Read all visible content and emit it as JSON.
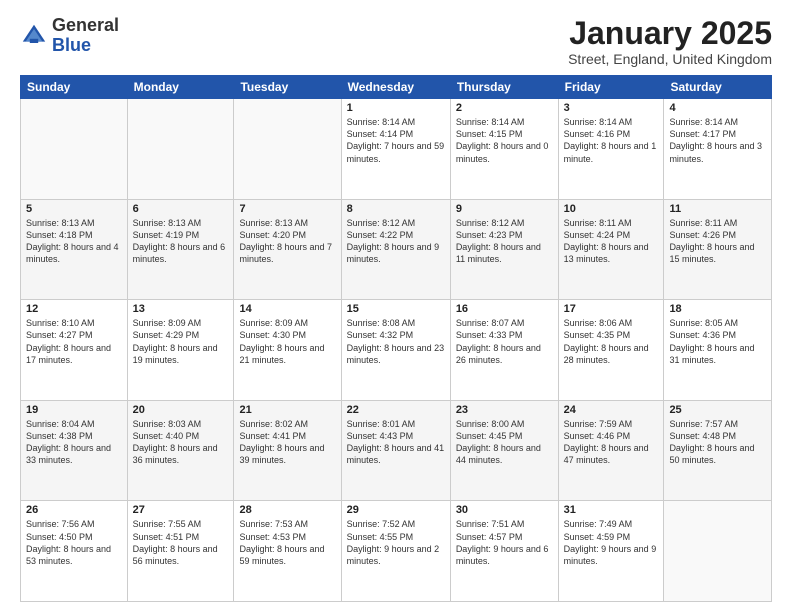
{
  "header": {
    "logo_general": "General",
    "logo_blue": "Blue",
    "title": "January 2025",
    "subtitle": "Street, England, United Kingdom"
  },
  "days_of_week": [
    "Sunday",
    "Monday",
    "Tuesday",
    "Wednesday",
    "Thursday",
    "Friday",
    "Saturday"
  ],
  "weeks": [
    [
      {
        "day": "",
        "sunrise": "",
        "sunset": "",
        "daylight": ""
      },
      {
        "day": "",
        "sunrise": "",
        "sunset": "",
        "daylight": ""
      },
      {
        "day": "",
        "sunrise": "",
        "sunset": "",
        "daylight": ""
      },
      {
        "day": "1",
        "sunrise": "Sunrise: 8:14 AM",
        "sunset": "Sunset: 4:14 PM",
        "daylight": "Daylight: 7 hours and 59 minutes."
      },
      {
        "day": "2",
        "sunrise": "Sunrise: 8:14 AM",
        "sunset": "Sunset: 4:15 PM",
        "daylight": "Daylight: 8 hours and 0 minutes."
      },
      {
        "day": "3",
        "sunrise": "Sunrise: 8:14 AM",
        "sunset": "Sunset: 4:16 PM",
        "daylight": "Daylight: 8 hours and 1 minute."
      },
      {
        "day": "4",
        "sunrise": "Sunrise: 8:14 AM",
        "sunset": "Sunset: 4:17 PM",
        "daylight": "Daylight: 8 hours and 3 minutes."
      }
    ],
    [
      {
        "day": "5",
        "sunrise": "Sunrise: 8:13 AM",
        "sunset": "Sunset: 4:18 PM",
        "daylight": "Daylight: 8 hours and 4 minutes."
      },
      {
        "day": "6",
        "sunrise": "Sunrise: 8:13 AM",
        "sunset": "Sunset: 4:19 PM",
        "daylight": "Daylight: 8 hours and 6 minutes."
      },
      {
        "day": "7",
        "sunrise": "Sunrise: 8:13 AM",
        "sunset": "Sunset: 4:20 PM",
        "daylight": "Daylight: 8 hours and 7 minutes."
      },
      {
        "day": "8",
        "sunrise": "Sunrise: 8:12 AM",
        "sunset": "Sunset: 4:22 PM",
        "daylight": "Daylight: 8 hours and 9 minutes."
      },
      {
        "day": "9",
        "sunrise": "Sunrise: 8:12 AM",
        "sunset": "Sunset: 4:23 PM",
        "daylight": "Daylight: 8 hours and 11 minutes."
      },
      {
        "day": "10",
        "sunrise": "Sunrise: 8:11 AM",
        "sunset": "Sunset: 4:24 PM",
        "daylight": "Daylight: 8 hours and 13 minutes."
      },
      {
        "day": "11",
        "sunrise": "Sunrise: 8:11 AM",
        "sunset": "Sunset: 4:26 PM",
        "daylight": "Daylight: 8 hours and 15 minutes."
      }
    ],
    [
      {
        "day": "12",
        "sunrise": "Sunrise: 8:10 AM",
        "sunset": "Sunset: 4:27 PM",
        "daylight": "Daylight: 8 hours and 17 minutes."
      },
      {
        "day": "13",
        "sunrise": "Sunrise: 8:09 AM",
        "sunset": "Sunset: 4:29 PM",
        "daylight": "Daylight: 8 hours and 19 minutes."
      },
      {
        "day": "14",
        "sunrise": "Sunrise: 8:09 AM",
        "sunset": "Sunset: 4:30 PM",
        "daylight": "Daylight: 8 hours and 21 minutes."
      },
      {
        "day": "15",
        "sunrise": "Sunrise: 8:08 AM",
        "sunset": "Sunset: 4:32 PM",
        "daylight": "Daylight: 8 hours and 23 minutes."
      },
      {
        "day": "16",
        "sunrise": "Sunrise: 8:07 AM",
        "sunset": "Sunset: 4:33 PM",
        "daylight": "Daylight: 8 hours and 26 minutes."
      },
      {
        "day": "17",
        "sunrise": "Sunrise: 8:06 AM",
        "sunset": "Sunset: 4:35 PM",
        "daylight": "Daylight: 8 hours and 28 minutes."
      },
      {
        "day": "18",
        "sunrise": "Sunrise: 8:05 AM",
        "sunset": "Sunset: 4:36 PM",
        "daylight": "Daylight: 8 hours and 31 minutes."
      }
    ],
    [
      {
        "day": "19",
        "sunrise": "Sunrise: 8:04 AM",
        "sunset": "Sunset: 4:38 PM",
        "daylight": "Daylight: 8 hours and 33 minutes."
      },
      {
        "day": "20",
        "sunrise": "Sunrise: 8:03 AM",
        "sunset": "Sunset: 4:40 PM",
        "daylight": "Daylight: 8 hours and 36 minutes."
      },
      {
        "day": "21",
        "sunrise": "Sunrise: 8:02 AM",
        "sunset": "Sunset: 4:41 PM",
        "daylight": "Daylight: 8 hours and 39 minutes."
      },
      {
        "day": "22",
        "sunrise": "Sunrise: 8:01 AM",
        "sunset": "Sunset: 4:43 PM",
        "daylight": "Daylight: 8 hours and 41 minutes."
      },
      {
        "day": "23",
        "sunrise": "Sunrise: 8:00 AM",
        "sunset": "Sunset: 4:45 PM",
        "daylight": "Daylight: 8 hours and 44 minutes."
      },
      {
        "day": "24",
        "sunrise": "Sunrise: 7:59 AM",
        "sunset": "Sunset: 4:46 PM",
        "daylight": "Daylight: 8 hours and 47 minutes."
      },
      {
        "day": "25",
        "sunrise": "Sunrise: 7:57 AM",
        "sunset": "Sunset: 4:48 PM",
        "daylight": "Daylight: 8 hours and 50 minutes."
      }
    ],
    [
      {
        "day": "26",
        "sunrise": "Sunrise: 7:56 AM",
        "sunset": "Sunset: 4:50 PM",
        "daylight": "Daylight: 8 hours and 53 minutes."
      },
      {
        "day": "27",
        "sunrise": "Sunrise: 7:55 AM",
        "sunset": "Sunset: 4:51 PM",
        "daylight": "Daylight: 8 hours and 56 minutes."
      },
      {
        "day": "28",
        "sunrise": "Sunrise: 7:53 AM",
        "sunset": "Sunset: 4:53 PM",
        "daylight": "Daylight: 8 hours and 59 minutes."
      },
      {
        "day": "29",
        "sunrise": "Sunrise: 7:52 AM",
        "sunset": "Sunset: 4:55 PM",
        "daylight": "Daylight: 9 hours and 2 minutes."
      },
      {
        "day": "30",
        "sunrise": "Sunrise: 7:51 AM",
        "sunset": "Sunset: 4:57 PM",
        "daylight": "Daylight: 9 hours and 6 minutes."
      },
      {
        "day": "31",
        "sunrise": "Sunrise: 7:49 AM",
        "sunset": "Sunset: 4:59 PM",
        "daylight": "Daylight: 9 hours and 9 minutes."
      },
      {
        "day": "",
        "sunrise": "",
        "sunset": "",
        "daylight": ""
      }
    ]
  ]
}
